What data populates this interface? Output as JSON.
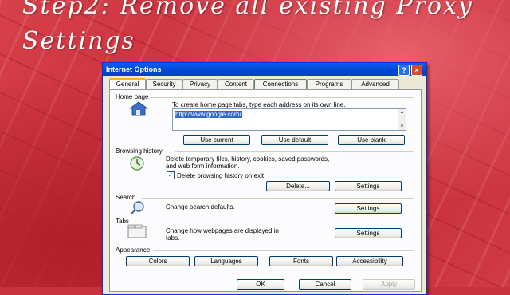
{
  "slide": {
    "title_line1": "Step2: Remove all existing Proxy",
    "title_line2": "Settings"
  },
  "dialog": {
    "title": "Internet Options",
    "help_glyph": "?",
    "close_glyph": "×",
    "tabs": [
      "General",
      "Security",
      "Privacy",
      "Content",
      "Connections",
      "Programs",
      "Advanced"
    ],
    "home_page": {
      "label": "Home page",
      "instruction": "To create home page tabs, type each address on its own line.",
      "url": "http://www.google.com/",
      "buttons": [
        "Use current",
        "Use default",
        "Use blank"
      ]
    },
    "browsing_history": {
      "label": "Browsing history",
      "description_line1": "Delete temporary files, history, cookies, saved passwords,",
      "description_line2": "and web form information.",
      "checkbox_label": "Delete browsing history on exit",
      "checkbox_checked": true,
      "checkmark": "✓",
      "buttons": [
        "Delete...",
        "Settings"
      ]
    },
    "search": {
      "label": "Search",
      "description": "Change search defaults.",
      "button": "Settings"
    },
    "tabs_section": {
      "label": "Tabs",
      "description_line1": "Change how webpages are displayed in",
      "description_line2": "tabs.",
      "button": "Settings"
    },
    "appearance": {
      "label": "Appearance",
      "buttons": [
        "Colors",
        "Languages",
        "Fonts",
        "Accessibility"
      ]
    },
    "footer": {
      "ok": "OK",
      "cancel": "Cancel",
      "apply": "Apply"
    }
  },
  "colors": {
    "slide_background": "#c8323c",
    "titlebar": "#0a5ef0",
    "selection": "#316ac5"
  }
}
